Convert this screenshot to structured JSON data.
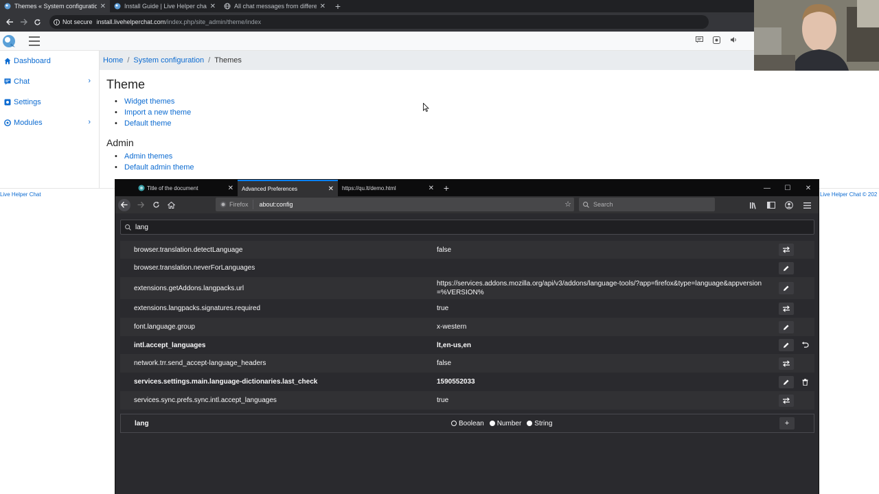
{
  "chrome": {
    "tabs": [
      {
        "title": "Themes « System configuration -"
      },
      {
        "title": "Install Guide | Live Helper chat"
      },
      {
        "title": "All chat messages from different"
      }
    ],
    "security_label": "Not secure",
    "url_host": "install.livehelperchat.com",
    "url_path": "/index.php/site_admin/theme/index"
  },
  "lhc": {
    "sidebar": [
      {
        "label": "Dashboard"
      },
      {
        "label": "Chat"
      },
      {
        "label": "Settings"
      },
      {
        "label": "Modules"
      }
    ],
    "breadcrumb": {
      "home": "Home",
      "sysconf": "System configuration",
      "current": "Themes",
      "sep": "/"
    },
    "theme_heading": "Theme",
    "theme_links": [
      "Widget themes",
      "Import a new theme",
      "Default theme"
    ],
    "admin_heading": "Admin",
    "admin_links": [
      "Admin themes",
      "Default admin theme"
    ],
    "footer_left": "Live Helper Chat",
    "footer_right": "Live Helper Chat © 202"
  },
  "firefox": {
    "tabs": [
      {
        "title": "Title of the document"
      },
      {
        "title": "Advanced Preferences"
      },
      {
        "title": "https://qu.lt/demo.html"
      }
    ],
    "identity_label": "Firefox",
    "url": "about:config",
    "search_placeholder": "Search",
    "pref_filter": "lang",
    "prefs": [
      {
        "name": "browser.translation.detectLanguage",
        "value": "false",
        "action": "toggle",
        "modified": false
      },
      {
        "name": "browser.translation.neverForLanguages",
        "value": "",
        "action": "edit",
        "modified": false
      },
      {
        "name": "extensions.getAddons.langpacks.url",
        "value": "https://services.addons.mozilla.org/api/v3/addons/language-tools/?app=firefox&type=language&appversion=%VERSION%",
        "action": "edit",
        "modified": false
      },
      {
        "name": "extensions.langpacks.signatures.required",
        "value": "true",
        "action": "toggle",
        "modified": false
      },
      {
        "name": "font.language.group",
        "value": "x-western",
        "action": "edit",
        "modified": false
      },
      {
        "name": "intl.accept_languages",
        "value": "lt,en-us,en",
        "action": "edit",
        "modified": true,
        "secondary": "reset"
      },
      {
        "name": "network.trr.send_accept-language_headers",
        "value": "false",
        "action": "toggle",
        "modified": false
      },
      {
        "name": "services.settings.main.language-dictionaries.last_check",
        "value": "1590552033",
        "action": "edit",
        "modified": true,
        "secondary": "delete"
      },
      {
        "name": "services.sync.prefs.sync.intl.accept_languages",
        "value": "true",
        "action": "toggle",
        "modified": false
      }
    ],
    "new_pref": {
      "name": "lang",
      "types": [
        "Boolean",
        "Number",
        "String"
      ],
      "selected": "Boolean"
    }
  },
  "colors": {
    "link": "#0c6bd1",
    "ff_bg": "#2a2a2e",
    "ff_accent": "#0a84ff"
  }
}
